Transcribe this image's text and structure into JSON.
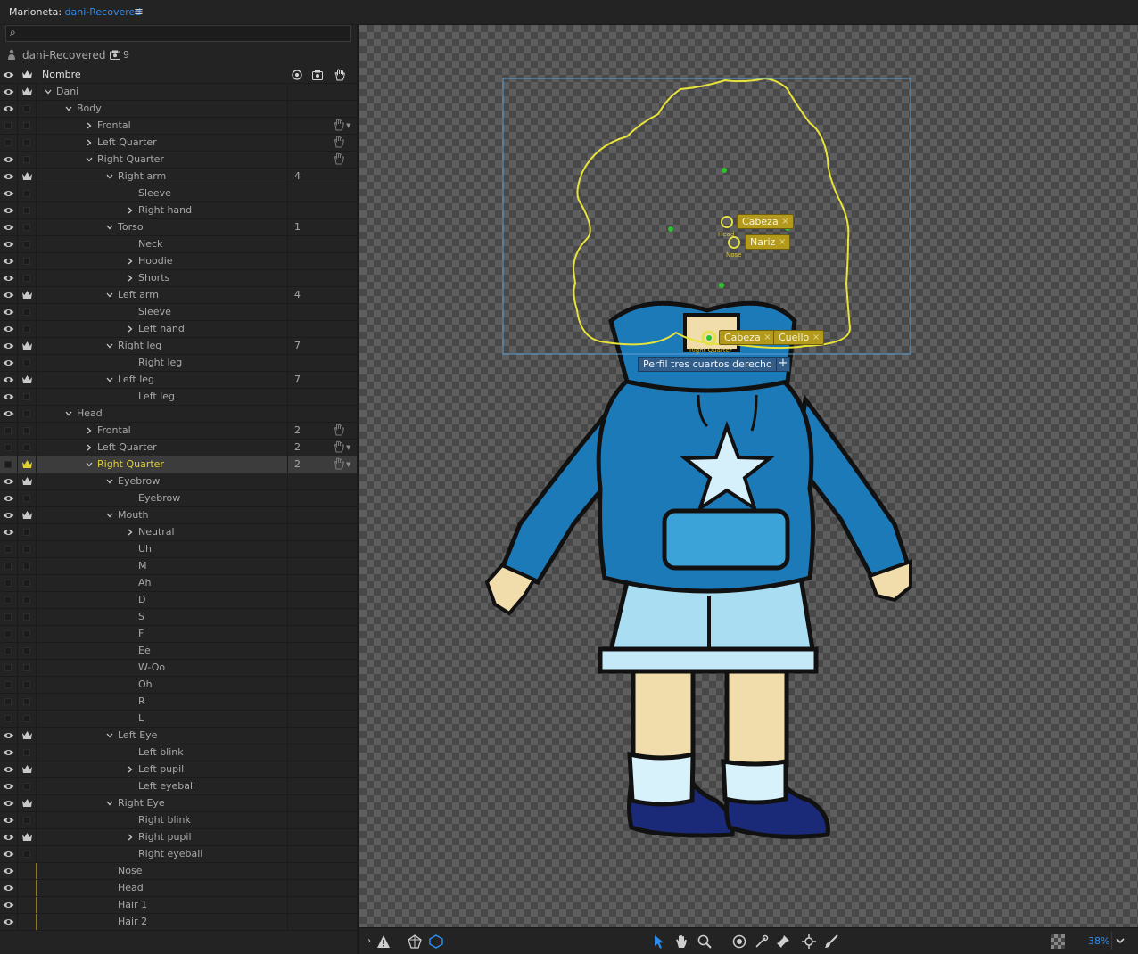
{
  "window": {
    "panel_label": "Marioneta:",
    "doc_name": "dani-Recovered",
    "menu_icon": "hamburger-icon"
  },
  "search": {
    "placeholder": "",
    "icon": "search-icon"
  },
  "puppet": {
    "name": "dani-Recovered",
    "count_icon": "camera-icon",
    "count": "9"
  },
  "header": {
    "label": "Nombre",
    "icons": [
      "target-icon",
      "camera-icon",
      "hand-icon"
    ]
  },
  "rows": [
    {
      "label": "Dani",
      "depth": 0,
      "chev": "open",
      "eye": true,
      "crown": true,
      "count": "",
      "hand": false
    },
    {
      "label": "Body",
      "depth": 1,
      "chev": "open",
      "eye": true,
      "crown": false,
      "count": "",
      "hand": false
    },
    {
      "label": "Frontal",
      "depth": 2,
      "chev": "closed",
      "eye": false,
      "crown": false,
      "count": "",
      "hand": true,
      "dd": true
    },
    {
      "label": "Left Quarter",
      "depth": 2,
      "chev": "closed",
      "eye": false,
      "crown": false,
      "count": "",
      "hand": true
    },
    {
      "label": "Right Quarter",
      "depth": 2,
      "chev": "open",
      "eye": true,
      "crown": false,
      "count": "",
      "hand": true
    },
    {
      "label": "Right arm",
      "depth": 3,
      "chev": "open",
      "eye": true,
      "crown": true,
      "count": "4",
      "hand": false
    },
    {
      "label": "Sleeve",
      "depth": 4,
      "chev": "",
      "eye": true,
      "crown": false,
      "count": "",
      "hand": false
    },
    {
      "label": "Right hand",
      "depth": 4,
      "chev": "closed",
      "eye": true,
      "crown": false,
      "count": "",
      "hand": false
    },
    {
      "label": "Torso",
      "depth": 3,
      "chev": "open",
      "eye": true,
      "crown": false,
      "count": "1",
      "hand": false
    },
    {
      "label": "Neck",
      "depth": 4,
      "chev": "",
      "eye": true,
      "crown": false,
      "count": "",
      "hand": false
    },
    {
      "label": "Hoodie",
      "depth": 4,
      "chev": "closed",
      "eye": true,
      "crown": false,
      "count": "",
      "hand": false
    },
    {
      "label": "Shorts",
      "depth": 4,
      "chev": "closed",
      "eye": true,
      "crown": false,
      "count": "",
      "hand": false
    },
    {
      "label": "Left arm",
      "depth": 3,
      "chev": "open",
      "eye": true,
      "crown": true,
      "count": "4",
      "hand": false
    },
    {
      "label": "Sleeve",
      "depth": 4,
      "chev": "",
      "eye": true,
      "crown": false,
      "count": "",
      "hand": false
    },
    {
      "label": "Left hand",
      "depth": 4,
      "chev": "closed",
      "eye": true,
      "crown": false,
      "count": "",
      "hand": false
    },
    {
      "label": "Right leg",
      "depth": 3,
      "chev": "open",
      "eye": true,
      "crown": true,
      "count": "7",
      "hand": false
    },
    {
      "label": "Right leg",
      "depth": 4,
      "chev": "",
      "eye": true,
      "crown": false,
      "count": "",
      "hand": false
    },
    {
      "label": "Left leg",
      "depth": 3,
      "chev": "open",
      "eye": true,
      "crown": true,
      "count": "7",
      "hand": false
    },
    {
      "label": "Left leg",
      "depth": 4,
      "chev": "",
      "eye": true,
      "crown": false,
      "count": "",
      "hand": false
    },
    {
      "label": "Head",
      "depth": 1,
      "chev": "open",
      "eye": true,
      "crown": false,
      "count": "",
      "hand": false
    },
    {
      "label": "Frontal",
      "depth": 2,
      "chev": "closed",
      "eye": false,
      "crown": false,
      "count": "2",
      "hand": true
    },
    {
      "label": "Left Quarter",
      "depth": 2,
      "chev": "closed",
      "eye": false,
      "crown": false,
      "count": "2",
      "hand": true,
      "dd": true
    },
    {
      "label": "Right Quarter",
      "depth": 2,
      "chev": "open",
      "eye": false,
      "crown": true,
      "count": "2",
      "hand": true,
      "dd": true,
      "selected": true
    },
    {
      "label": "Eyebrow",
      "depth": 3,
      "chev": "open",
      "eye": true,
      "crown": true,
      "count": "",
      "hand": false
    },
    {
      "label": "Eyebrow",
      "depth": 4,
      "chev": "",
      "eye": true,
      "crown": false,
      "count": "",
      "hand": false
    },
    {
      "label": "Mouth",
      "depth": 3,
      "chev": "open",
      "eye": true,
      "crown": true,
      "count": "",
      "hand": false
    },
    {
      "label": "Neutral",
      "depth": 4,
      "chev": "closed",
      "eye": true,
      "crown": false,
      "count": "",
      "hand": false
    },
    {
      "label": "Uh",
      "depth": 4,
      "chev": "",
      "eye": false,
      "crown": false,
      "count": "",
      "hand": false
    },
    {
      "label": "M",
      "depth": 4,
      "chev": "",
      "eye": false,
      "crown": false,
      "count": "",
      "hand": false
    },
    {
      "label": "Ah",
      "depth": 4,
      "chev": "",
      "eye": false,
      "crown": false,
      "count": "",
      "hand": false
    },
    {
      "label": "D",
      "depth": 4,
      "chev": "",
      "eye": false,
      "crown": false,
      "count": "",
      "hand": false
    },
    {
      "label": "S",
      "depth": 4,
      "chev": "",
      "eye": false,
      "crown": false,
      "count": "",
      "hand": false
    },
    {
      "label": "F",
      "depth": 4,
      "chev": "",
      "eye": false,
      "crown": false,
      "count": "",
      "hand": false
    },
    {
      "label": "Ee",
      "depth": 4,
      "chev": "",
      "eye": false,
      "crown": false,
      "count": "",
      "hand": false
    },
    {
      "label": "W-Oo",
      "depth": 4,
      "chev": "",
      "eye": false,
      "crown": false,
      "count": "",
      "hand": false
    },
    {
      "label": "Oh",
      "depth": 4,
      "chev": "",
      "eye": false,
      "crown": false,
      "count": "",
      "hand": false
    },
    {
      "label": "R",
      "depth": 4,
      "chev": "",
      "eye": false,
      "crown": false,
      "count": "",
      "hand": false
    },
    {
      "label": "L",
      "depth": 4,
      "chev": "",
      "eye": false,
      "crown": false,
      "count": "",
      "hand": false
    },
    {
      "label": "Left Eye",
      "depth": 3,
      "chev": "open",
      "eye": true,
      "crown": true,
      "count": "",
      "hand": false
    },
    {
      "label": "Left blink",
      "depth": 4,
      "chev": "",
      "eye": true,
      "crown": false,
      "count": "",
      "hand": false
    },
    {
      "label": "Left pupil",
      "depth": 4,
      "chev": "closed",
      "eye": true,
      "crown": true,
      "count": "",
      "hand": false
    },
    {
      "label": "Left eyeball",
      "depth": 4,
      "chev": "",
      "eye": true,
      "crown": false,
      "count": "",
      "hand": false
    },
    {
      "label": "Right Eye",
      "depth": 3,
      "chev": "open",
      "eye": true,
      "crown": true,
      "count": "",
      "hand": false
    },
    {
      "label": "Right blink",
      "depth": 4,
      "chev": "",
      "eye": true,
      "crown": false,
      "count": "",
      "hand": false
    },
    {
      "label": "Right pupil",
      "depth": 4,
      "chev": "closed",
      "eye": true,
      "crown": true,
      "count": "",
      "hand": false
    },
    {
      "label": "Right eyeball",
      "depth": 4,
      "chev": "",
      "eye": true,
      "crown": false,
      "count": "",
      "hand": false
    },
    {
      "label": "Nose",
      "depth": 3,
      "chev": "",
      "eye": true,
      "crown": false,
      "count": "",
      "hand": false,
      "ybar": true
    },
    {
      "label": "Head",
      "depth": 3,
      "chev": "",
      "eye": true,
      "crown": false,
      "count": "",
      "hand": false,
      "ybar": true
    },
    {
      "label": "Hair 1",
      "depth": 3,
      "chev": "",
      "eye": true,
      "crown": false,
      "count": "",
      "hand": false,
      "ybar": true
    },
    {
      "label": "Hair 2",
      "depth": 3,
      "chev": "",
      "eye": true,
      "crown": false,
      "count": "",
      "hand": false,
      "ybar": true
    }
  ],
  "canvas": {
    "tags": {
      "cabeza_top": "Cabeza",
      "nariz": "Nariz",
      "cabeza_bottom": "Cabeza",
      "cuello": "Cuello",
      "perfil": "Perfil tres cuartos derecho",
      "plus": "+",
      "close": "×"
    },
    "small_labels": {
      "head": "Head",
      "nose": "Nose",
      "right_quarter": "Right Quarter"
    },
    "colors": {
      "handle": "#e4e04a",
      "bounds": "#5d9fd3",
      "tag": "#b39a1d",
      "hoodie": "#1d7ab8"
    }
  },
  "toolbar": {
    "left": [
      "expand-icon",
      "warning-icon",
      "transparency-icon",
      "mesh-icon"
    ],
    "center": [
      "select-arrow-icon",
      "hand-pan-icon",
      "zoom-icon",
      "origin-icon",
      "pin-icon",
      "stick-icon",
      "dragger-icon",
      "handle-brush-icon"
    ],
    "zoom": "38%"
  }
}
